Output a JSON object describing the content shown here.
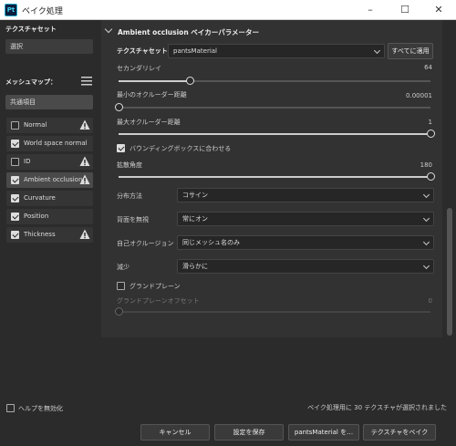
{
  "window": {
    "title": "ベイク処理",
    "app_icon": "Pt",
    "minimize": "–",
    "maximize": "☐",
    "close": "✕"
  },
  "left": {
    "texture_set_title": "テクスチャセット",
    "texture_set_value": "選択",
    "mesh_map_title": "メッシュマップ：",
    "common_item": "共通項目",
    "items": [
      {
        "label": "Normal",
        "checked": false,
        "warning": true,
        "selected": false
      },
      {
        "label": "World space normal",
        "checked": true,
        "warning": false,
        "selected": false
      },
      {
        "label": "ID",
        "checked": false,
        "warning": true,
        "selected": false
      },
      {
        "label": "Ambient occlusion",
        "checked": true,
        "warning": true,
        "selected": true
      },
      {
        "label": "Curvature",
        "checked": true,
        "warning": false,
        "selected": false
      },
      {
        "label": "Position",
        "checked": true,
        "warning": false,
        "selected": false
      },
      {
        "label": "Thickness",
        "checked": true,
        "warning": true,
        "selected": false
      }
    ]
  },
  "params": {
    "header": "Ambient occlusion ベイカーパラメーター",
    "texture_set_label": "テクスチャセット",
    "texture_set_value": "pantsMaterial",
    "apply_all": "すべてに適用",
    "secondary_rays_label": "セカンダリレイ",
    "secondary_rays_value": "64",
    "secondary_rays_fraction": 0.23,
    "min_dist_label": "最小のオクルーダー距離",
    "min_dist_value": "0.00001",
    "min_dist_fraction": 0.0,
    "max_dist_label": "最大オクルーダー距離",
    "max_dist_value": "1",
    "max_dist_fraction": 1.0,
    "bbox_label": "バウンディングボックスに合わせる",
    "bbox_checked": true,
    "spread_label": "拡散角度",
    "spread_value": "180",
    "spread_fraction": 1.0,
    "distribution_label": "分布方法",
    "distribution_value": "コサイン",
    "ignore_backface_label": "背面を無視",
    "ignore_backface_value": "常にオン",
    "self_occlusion_label": "自己オクルージョン",
    "self_occlusion_value": "同じメッシュ名のみ",
    "attenuation_label": "減少",
    "attenuation_value": "滑らかに",
    "ground_plane_label": "グランドプレーン",
    "ground_plane_checked": false,
    "ground_offset_label": "グランドプレーンオフセット",
    "ground_offset_value": "0",
    "ground_offset_fraction": 0.0
  },
  "footer": {
    "disable_help": "ヘルプを無効化",
    "status": "ベイク処理用に 30 テクスチャが選択されました",
    "cancel": "キャンセル",
    "save_settings": "設定を保存",
    "bake_material": "pantsMaterial を…",
    "bake_textures": "テクスチャをベイク"
  },
  "colors": {
    "warning": "#dddddd",
    "background": "#2b2b2b",
    "panel": "#323232"
  }
}
